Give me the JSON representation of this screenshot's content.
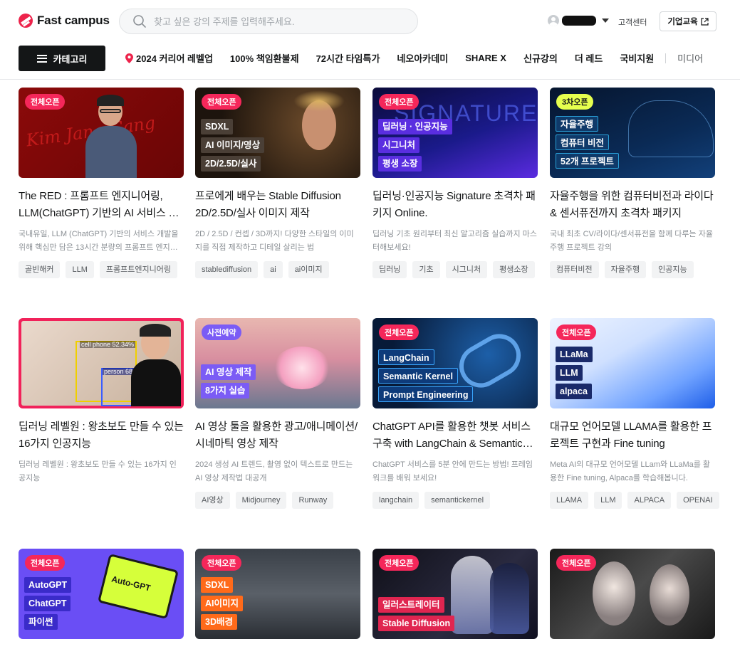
{
  "header": {
    "logo_text": "Fast campus",
    "search_placeholder": "찾고 싶은 강의 주제를 입력해주세요.",
    "support_label": "고객센터",
    "biz_label": "기업교육"
  },
  "nav": {
    "category_label": "카테고리",
    "items": [
      "2024 커리어 레벨업",
      "100% 책임환불제",
      "72시간 타임특가",
      "네오아카데미",
      "SHARE X",
      "신규강의",
      "더 레드",
      "국비지원"
    ],
    "extra": "미디어"
  },
  "courses": [
    {
      "badge": "전체오픈",
      "thumb_tags": [],
      "thumb_text": "Kim Jang Gang",
      "title": "The RED : 프롬프트 엔지니어링, LLM(ChatGPT) 기반의 AI 서비스 개발",
      "desc": "국내유일, LLM (ChatGPT) 기반의 서비스 개발을 위해 핵심만 담은 13시간 분량의 프롬프트 엔지니어링",
      "tags": [
        "골빈해커",
        "LLM",
        "프롬프트엔지니어링"
      ]
    },
    {
      "badge": "전체오픈",
      "thumb_tags": [
        "SDXL",
        "AI 이미지/영상",
        "2D/2.5D/실사"
      ],
      "title": "프로에게 배우는 Stable Diffusion 2D/2.5D/실사 이미지 제작",
      "desc": "2D / 2.5D / 컨셉 / 3D까지! 다양한 스타일의 이미지를 직접 제작하고 디테일 살리는 법",
      "tags": [
        "stablediffusion",
        "ai",
        "ai이미지"
      ]
    },
    {
      "badge": "전체오픈",
      "thumb_tags": [
        "딥러닝 · 인공지능",
        "시그니처",
        "평생 소장"
      ],
      "thumb_text": "SIGNATURE",
      "title": "딥러닝·인공지능 Signature 초격차 패키지 Online.",
      "desc": "딥러닝 기초 원리부터 최신 알고리즘 실습까지 마스터해보세요!",
      "tags": [
        "딥러닝",
        "기초",
        "시그니처",
        "평생소장"
      ]
    },
    {
      "badge": "3차오픈",
      "thumb_tags": [
        "자율주행",
        "컴퓨터 비전",
        "52개 프로젝트"
      ],
      "title": "자율주행을 위한 컴퓨터비전과 라이다 & 센서퓨전까지 초격차 패키지",
      "desc": "국내 최초 CV/라이다/센서퓨전을 함께 다루는 자율주행 프로젝트 강의",
      "tags": [
        "컴퓨터비전",
        "자율주행",
        "인공지능"
      ]
    },
    {
      "badge": "",
      "thumb_tags": [],
      "thumb_labels": [
        "cell phone 52.34%",
        "person 68.75%"
      ],
      "title": "딥러닝 레벨원 : 왕초보도 만들 수 있는 16가지 인공지능",
      "desc": "딥러닝 레벨원 : 왕초보도 만들 수 있는 16가지 인공지능",
      "tags": []
    },
    {
      "badge": "사전예약",
      "thumb_tags": [
        "AI 영상 제작",
        "8가지 실습"
      ],
      "title": "AI 영상 툴을 활용한 광고/애니메이션/시네마틱 영상 제작",
      "desc": "2024 생성 AI 트렌드, 촬영 없이 텍스트로 만드는 AI 영상 제작법 대공개",
      "tags": [
        "AI영상",
        "Midjourney",
        "Runway"
      ]
    },
    {
      "badge": "전체오픈",
      "thumb_tags": [
        "LangChain",
        "Semantic Kernel",
        "Prompt Engineering"
      ],
      "title": "ChatGPT API를 활용한 챗봇 서비스 구축 with LangChain & Semantic Kernel",
      "desc": "ChatGPT 서비스를 5분 안에 만드는 방법! 프레임워크를 배워 보세요!",
      "tags": [
        "langchain",
        "semantickernel"
      ]
    },
    {
      "badge": "전체오픈",
      "thumb_tags": [
        "LLaMa",
        "LLM",
        "alpaca"
      ],
      "title": "대규모 언어모델 LLAMA를 활용한 프로젝트 구현과 Fine tuning",
      "desc": "Meta AI의 대규모 언어모델 LLam와 LLaMa를 활용한 Fine tuning, Alpaca를 학습해봅니다.",
      "tags": [
        "LLAMA",
        "LLM",
        "ALPACA",
        "OPENAI"
      ]
    },
    {
      "badge": "전체오픈",
      "thumb_tags": [
        "AutoGPT",
        "ChatGPT",
        "파이썬"
      ],
      "thumb_text": "Auto-GPT",
      "title": "",
      "desc": "",
      "tags": []
    },
    {
      "badge": "전체오픈",
      "thumb_tags": [
        "SDXL",
        "AI이미지",
        "3D배경"
      ],
      "title": "",
      "desc": "",
      "tags": []
    },
    {
      "badge": "전체오픈",
      "thumb_tags": [
        "일러스트레이터",
        "Stable Diffusion"
      ],
      "title": "",
      "desc": "",
      "tags": []
    },
    {
      "badge": "전체오픈",
      "thumb_tags": [],
      "title": "",
      "desc": "",
      "tags": []
    }
  ],
  "colors": {
    "brand_red": "#ed234b",
    "badge_pink": "#f5275a",
    "badge_yellow": "#e6ff4e",
    "badge_purple": "#7b5cf5"
  }
}
